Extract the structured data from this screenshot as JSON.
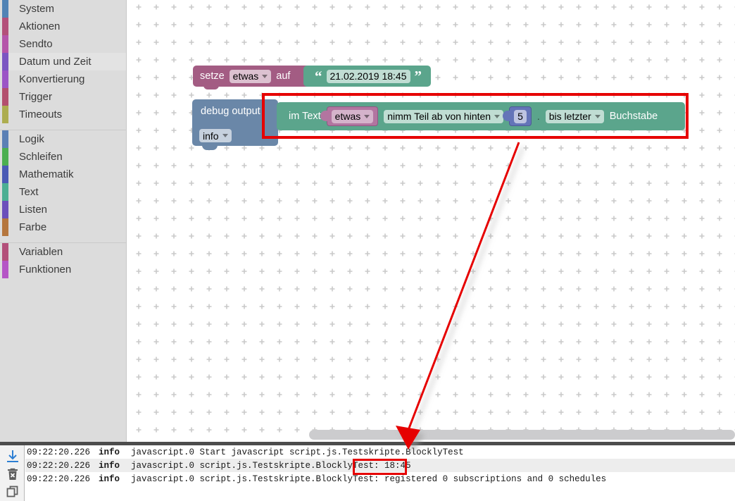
{
  "toolbox": {
    "name": "blockly-toolbox",
    "groups": [
      {
        "items": [
          {
            "label": "System",
            "color": "#5083b5",
            "selected": false
          },
          {
            "label": "Aktionen",
            "color": "#b3507a",
            "selected": false
          },
          {
            "label": "Sendto",
            "color": "#b555aa",
            "selected": false
          },
          {
            "label": "Datum und Zeit",
            "color": "#7b56c2",
            "selected": true
          },
          {
            "label": "Konvertierung",
            "color": "#9c55c6",
            "selected": false
          },
          {
            "label": "Trigger",
            "color": "#b3506e",
            "selected": false
          },
          {
            "label": "Timeouts",
            "color": "#adad4f",
            "selected": false
          }
        ]
      },
      {
        "items": [
          {
            "label": "Logik",
            "color": "#5b80b5",
            "selected": false
          },
          {
            "label": "Schleifen",
            "color": "#4caf50",
            "selected": false
          },
          {
            "label": "Mathematik",
            "color": "#4a5ab5",
            "selected": false
          },
          {
            "label": "Text",
            "color": "#4caf93",
            "selected": false
          },
          {
            "label": "Listen",
            "color": "#6b4fbb",
            "selected": false
          },
          {
            "label": "Farbe",
            "color": "#b5763d",
            "selected": false
          }
        ]
      },
      {
        "items": [
          {
            "label": "Variablen",
            "color": "#b3507a",
            "selected": false
          },
          {
            "label": "Funktionen",
            "color": "#b555c6",
            "selected": false
          }
        ]
      }
    ]
  },
  "workspace": {
    "name": "blockly-workspace",
    "blocks": {
      "set_block": {
        "keyword": "setze",
        "variable": "etwas",
        "connector": "auf",
        "color": "#a35c83"
      },
      "text_literal": {
        "value": "21.02.2019 18:45",
        "open_quote": "“",
        "close_quote": "”",
        "color": "#5ba58c"
      },
      "debug_block": {
        "title": "debug output",
        "level": "info",
        "color": "#6a87a8"
      },
      "substring_block": {
        "prefix": "im Text",
        "variable": "etwas",
        "mode": "nimm Teil ab von hinten",
        "index": "5",
        "separator": ".",
        "end_mode": "bis letzter",
        "suffix": "Buchstabe",
        "color": "#5ba58c"
      }
    }
  },
  "annotations": {
    "highlight_rect_label": "highlight-substring-block",
    "arrow_label": "arrow-block-to-log",
    "highlight_log_label": "highlight-log-result",
    "color": "#e60000"
  },
  "console": {
    "name": "log-console",
    "gutter_icons": [
      {
        "name": "download-icon",
        "glyph": "↓"
      },
      {
        "name": "delete-all-icon",
        "glyph": "⌧"
      },
      {
        "name": "copy-icon",
        "glyph": "❐"
      }
    ],
    "columns": [
      "time",
      "level",
      "message"
    ],
    "rows": [
      {
        "time": "09:22:20.226",
        "level": "info",
        "message": "javascript.0 Start javascript script.js.Testskripte.BlocklyTest"
      },
      {
        "time": "09:22:20.226",
        "level": "info",
        "message": "javascript.0 script.js.Testskripte.BlocklyTest: 18:45"
      },
      {
        "time": "09:22:20.226",
        "level": "info",
        "message": "javascript.0 script.js.Testskripte.BlocklyTest: registered 0 subscriptions and 0 schedules"
      }
    ]
  }
}
